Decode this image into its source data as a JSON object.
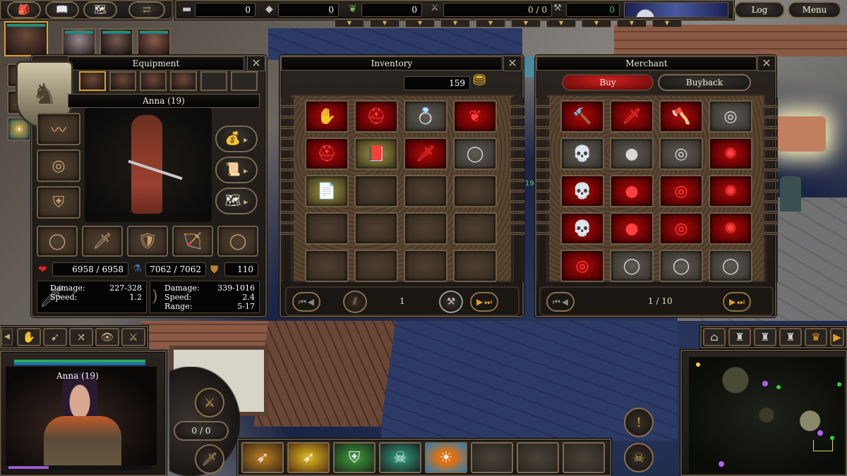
{
  "top_bar": {
    "menu_icons": [
      {
        "name": "inventory-bag-icon",
        "glyph": "🎒"
      },
      {
        "name": "spellbook-icon",
        "glyph": "📖"
      },
      {
        "name": "quest-map-icon",
        "glyph": "🗺"
      }
    ],
    "party_swap_icon": "⇄",
    "resources": [
      {
        "name": "stone",
        "icon": "▬",
        "value": "0"
      },
      {
        "name": "iron",
        "icon": "◆",
        "value": "0"
      },
      {
        "name": "wood-leaf",
        "icon": "❦",
        "value": "0"
      }
    ],
    "population": {
      "icon": "⚔",
      "value": "0 / 0"
    },
    "workers": {
      "icon": "⚒",
      "value": "0"
    },
    "log_label": "Log",
    "menu_label": "Menu",
    "dropdown_tab_glyph": "▼",
    "dropdown_tab_count": 10
  },
  "party": {
    "active_portrait": "Anna",
    "members": [
      "Anna",
      "Elf Warrior",
      "Hooded Woman",
      "Helmeted Fighter"
    ]
  },
  "left_quickbar": [
    {
      "name": "arrow-skill-1",
      "glyph": "➶"
    },
    {
      "name": "arrow-skill-2",
      "glyph": "➶"
    },
    {
      "name": "fire-aura-skill",
      "glyph": "☀"
    }
  ],
  "equipment": {
    "title": "Equipment",
    "close_glyph": "✕",
    "hero_tabs": [
      "Anna",
      "Elf Warrior",
      "Hooded Woman",
      "Helmeted Fighter",
      "",
      ""
    ],
    "hero_name": "Anna (19)",
    "left_slots": [
      {
        "name": "headband-slot",
        "glyph": "〰"
      },
      {
        "name": "amulet-slot",
        "glyph": "◎"
      },
      {
        "name": "armor-slot",
        "glyph": "⛨"
      }
    ],
    "right_buttons": [
      {
        "name": "gold-pouch-button",
        "glyph": "💰"
      },
      {
        "name": "scroll-button",
        "glyph": "📜"
      },
      {
        "name": "map-button",
        "glyph": "🗺"
      }
    ],
    "bottom_slots": [
      {
        "name": "ring-left-slot",
        "glyph": "◯"
      },
      {
        "name": "sword-slot",
        "glyph": "🗡"
      },
      {
        "name": "shield-slot",
        "glyph": "🛡"
      },
      {
        "name": "bow-slot",
        "glyph": "🏹"
      },
      {
        "name": "ring-right-slot",
        "glyph": "◯"
      }
    ],
    "health": "6958 / 6958",
    "mana": "7062 / 7062",
    "armor": "110",
    "melee": {
      "damage_label": "Damage:",
      "damage": "227-328",
      "speed_label": "Speed:",
      "speed": "1.2"
    },
    "ranged": {
      "damage_label": "Damage:",
      "damage": "339-1016",
      "speed_label": "Speed:",
      "speed": "2.4",
      "range_label": "Range:",
      "range": "5-17"
    }
  },
  "inventory": {
    "title": "Inventory",
    "close_glyph": "✕",
    "gold": "159",
    "page": "1",
    "items": [
      {
        "name": "red-glove",
        "style": "red",
        "glyph": "✋"
      },
      {
        "name": "red-hood",
        "style": "red",
        "glyph": "⛑"
      },
      {
        "name": "steel-ring-gem",
        "style": "grey",
        "glyph": "💍"
      },
      {
        "name": "red-cloak",
        "style": "red",
        "glyph": "❦"
      },
      {
        "name": "red-helmet",
        "style": "red",
        "glyph": "⛑"
      },
      {
        "name": "tome",
        "style": "gold",
        "glyph": "📕"
      },
      {
        "name": "red-dagger",
        "style": "red",
        "glyph": "🗡"
      },
      {
        "name": "steel-ring",
        "style": "grey",
        "glyph": "◯"
      },
      {
        "name": "paper-note",
        "style": "gold",
        "glyph": "📄"
      },
      {
        "name": "",
        "style": "",
        "glyph": ""
      },
      {
        "name": "",
        "style": "",
        "glyph": ""
      },
      {
        "name": "",
        "style": "",
        "glyph": ""
      },
      {
        "name": "",
        "style": "",
        "glyph": ""
      },
      {
        "name": "",
        "style": "",
        "glyph": ""
      },
      {
        "name": "",
        "style": "",
        "glyph": ""
      },
      {
        "name": "",
        "style": "",
        "glyph": ""
      },
      {
        "name": "",
        "style": "",
        "glyph": ""
      },
      {
        "name": "",
        "style": "",
        "glyph": ""
      },
      {
        "name": "",
        "style": "",
        "glyph": ""
      },
      {
        "name": "",
        "style": "",
        "glyph": ""
      }
    ]
  },
  "merchant": {
    "title": "Merchant",
    "close_glyph": "✕",
    "buy_label": "Buy",
    "buyback_label": "Buyback",
    "page": "1 / 10",
    "items": [
      {
        "name": "red-hammer",
        "style": "red",
        "glyph": "🔨"
      },
      {
        "name": "red-sword",
        "style": "red",
        "glyph": "🗡"
      },
      {
        "name": "red-axe",
        "style": "red",
        "glyph": "🪓"
      },
      {
        "name": "silver-amulet",
        "style": "grey",
        "glyph": "◎"
      },
      {
        "name": "skull-amulet",
        "style": "grey",
        "glyph": "💀"
      },
      {
        "name": "pearl-amulet",
        "style": "grey",
        "glyph": "●"
      },
      {
        "name": "teal-amulet",
        "style": "grey",
        "glyph": "◎"
      },
      {
        "name": "red-lion-amulet",
        "style": "red",
        "glyph": "✺"
      },
      {
        "name": "red-skull-amulet",
        "style": "red",
        "glyph": "💀"
      },
      {
        "name": "red-orb-amulet",
        "style": "red",
        "glyph": "●"
      },
      {
        "name": "red-swirl-amulet",
        "style": "red",
        "glyph": "◎"
      },
      {
        "name": "red-lion-amulet-2",
        "style": "red",
        "glyph": "✺"
      },
      {
        "name": "red-skull-amulet-2",
        "style": "red",
        "glyph": "💀"
      },
      {
        "name": "red-orb-amulet-2",
        "style": "red",
        "glyph": "●"
      },
      {
        "name": "red-swirl-amulet-2",
        "style": "red",
        "glyph": "◎"
      },
      {
        "name": "red-lion-amulet-3",
        "style": "red",
        "glyph": "✺"
      },
      {
        "name": "red-swirl-amulet-3",
        "style": "red",
        "glyph": "◎"
      },
      {
        "name": "ruby-ring",
        "style": "grey",
        "glyph": "◯"
      },
      {
        "name": "gold-ring",
        "style": "grey",
        "glyph": "◯"
      },
      {
        "name": "ruby-ring-2",
        "style": "grey",
        "glyph": "◯"
      }
    ]
  },
  "action_bar": [
    {
      "name": "hand-action",
      "glyph": "✋"
    },
    {
      "name": "attack-action",
      "glyph": "➹"
    },
    {
      "name": "cycle-action",
      "glyph": "⤨"
    },
    {
      "name": "look-action",
      "glyph": "👁"
    },
    {
      "name": "crossed-swords-action",
      "glyph": "⚔"
    }
  ],
  "hero_panel": {
    "name": "Anna (19)",
    "health_fraction": 1.0,
    "mana_fraction": 1.0,
    "xp_fraction": 0.28
  },
  "side_controls": {
    "counter": "0 / 0",
    "top_glyph": "⚔",
    "bottom_glyph": "🗡"
  },
  "hotbar": [
    {
      "name": "gauntlet-arrow-skill",
      "glyph": "➶"
    },
    {
      "name": "multishot-skill",
      "glyph": "➶"
    },
    {
      "name": "iron-maiden-skill",
      "glyph": "⛨"
    },
    {
      "name": "dark-figure-skill",
      "glyph": "☠"
    },
    {
      "name": "fire-ring-skill",
      "glyph": "☀"
    },
    {
      "name": "",
      "glyph": ""
    },
    {
      "name": "",
      "glyph": ""
    },
    {
      "name": "",
      "glyph": ""
    }
  ],
  "right_controls": {
    "alert_glyph": "!",
    "skull_glyph": "☠"
  },
  "building_tabs": [
    {
      "name": "townhall-tab",
      "glyph": "⌂"
    },
    {
      "name": "fortress-tab-1",
      "glyph": "♜"
    },
    {
      "name": "fortress-tab-2",
      "glyph": "♜"
    },
    {
      "name": "fortress-tab-3",
      "glyph": "♜"
    },
    {
      "name": "crown-tab",
      "glyph": "♛"
    },
    {
      "name": "expand-tab",
      "glyph": "▶"
    }
  ],
  "world_labels": {
    "unit_level": "(19)"
  },
  "colors": {
    "frame_gold": "#6e6048",
    "health_green": "#2aa85a",
    "mana_blue": "#1a70b0",
    "xp_purple": "#9a5ad0",
    "buy_red": "#a01010",
    "page_orange": "#e0a020"
  }
}
